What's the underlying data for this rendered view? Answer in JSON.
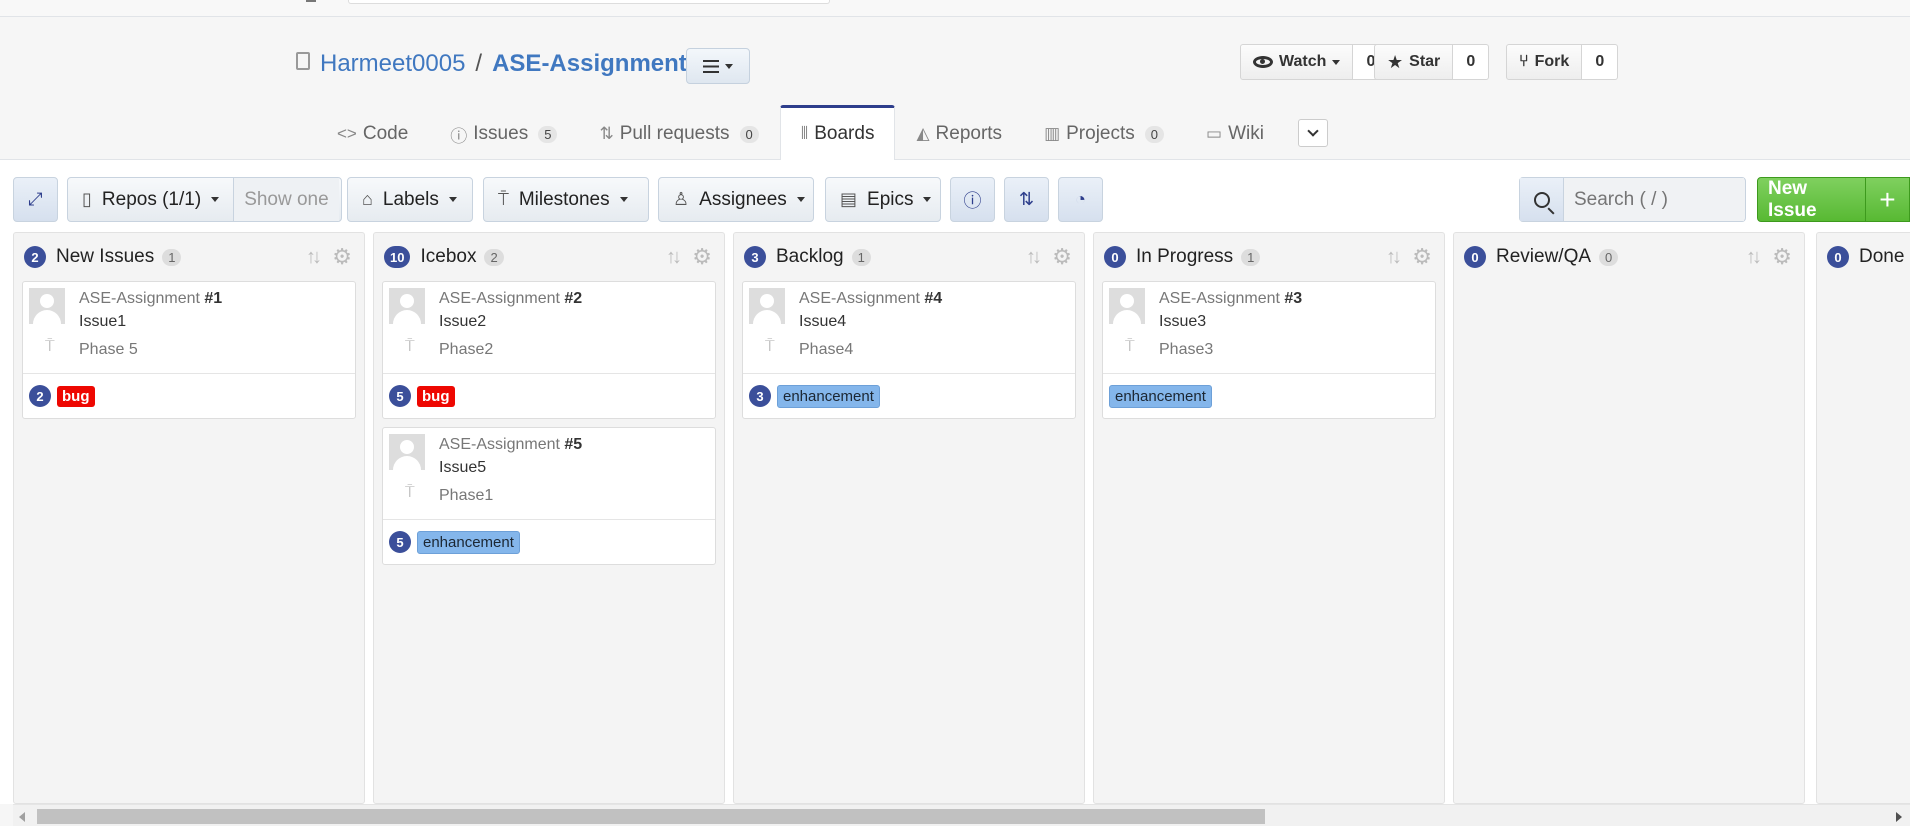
{
  "repo": {
    "owner": "Harmeet0005",
    "separator": "/",
    "name": "ASE-Assignment"
  },
  "social": {
    "watch": {
      "label": "Watch",
      "count": "0"
    },
    "star": {
      "label": "Star",
      "count": "0"
    },
    "fork": {
      "label": "Fork",
      "count": "0"
    }
  },
  "tabs": [
    {
      "label": "Code",
      "icon": "code-icon"
    },
    {
      "label": "Issues",
      "counter": "5",
      "icon": "issue-icon"
    },
    {
      "label": "Pull requests",
      "counter": "0",
      "icon": "pull-request-icon"
    },
    {
      "label": "Boards",
      "icon": "boards-icon",
      "active": true
    },
    {
      "label": "Reports",
      "icon": "reports-icon"
    },
    {
      "label": "Projects",
      "counter": "0",
      "icon": "projects-icon"
    },
    {
      "label": "Wiki",
      "icon": "wiki-icon"
    }
  ],
  "toolbar": {
    "repos_label": "Repos (1/1)",
    "show_one": "Show one",
    "labels": "Labels",
    "milestones": "Milestones",
    "assignees": "Assignees",
    "epics": "Epics",
    "search_placeholder": "Search ( / )",
    "new_issue": "New Issue",
    "plus": "+"
  },
  "columns": [
    {
      "title": "New Issues",
      "pill": "2",
      "count": "1",
      "cards": [
        {
          "repo": "ASE-Assignment",
          "num": "#1",
          "title": "Issue1",
          "milestone": "Phase 5",
          "estimate": "2",
          "label": "bug",
          "label_type": "bug"
        }
      ]
    },
    {
      "title": "Icebox",
      "pill": "10",
      "count": "2",
      "cards": [
        {
          "repo": "ASE-Assignment",
          "num": "#2",
          "title": "Issue2",
          "milestone": "Phase2",
          "estimate": "5",
          "label": "bug",
          "label_type": "bug"
        },
        {
          "repo": "ASE-Assignment",
          "num": "#5",
          "title": "Issue5",
          "milestone": "Phase1",
          "estimate": "5",
          "label": "enhancement",
          "label_type": "enh"
        }
      ]
    },
    {
      "title": "Backlog",
      "pill": "3",
      "count": "1",
      "cards": [
        {
          "repo": "ASE-Assignment",
          "num": "#4",
          "title": "Issue4",
          "milestone": "Phase4",
          "estimate": "3",
          "label": "enhancement",
          "label_type": "enh"
        }
      ]
    },
    {
      "title": "In Progress",
      "pill": "0",
      "count": "1",
      "cards": [
        {
          "repo": "ASE-Assignment",
          "num": "#3",
          "title": "Issue3",
          "milestone": "Phase3",
          "estimate": "",
          "label": "enhancement",
          "label_type": "enh"
        }
      ]
    },
    {
      "title": "Review/QA",
      "pill": "0",
      "count": "0",
      "cards": []
    },
    {
      "title": "Done",
      "pill": "0",
      "count": "",
      "cards": []
    }
  ],
  "colors": {
    "accent": "#2e3e8c",
    "link": "#4078c0",
    "bug": "#ee0701",
    "enhancement": "#84b6eb",
    "new_issue_green": "#58b933"
  }
}
